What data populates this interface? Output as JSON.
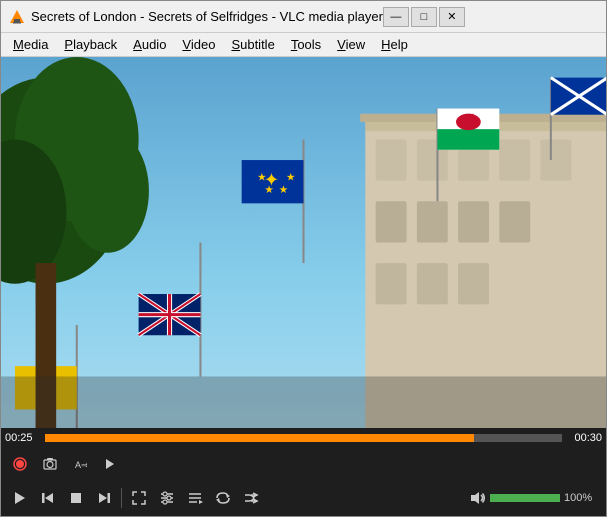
{
  "window": {
    "title": "Secrets of London - Secrets of Selfridges - VLC media player",
    "icon": "▶"
  },
  "titlebar": {
    "minimize": "—",
    "maximize": "□",
    "close": "✕"
  },
  "menu": {
    "items": [
      {
        "id": "media",
        "label": "Media",
        "underline": "M"
      },
      {
        "id": "playback",
        "label": "Playback",
        "underline": "P"
      },
      {
        "id": "audio",
        "label": "Audio",
        "underline": "A"
      },
      {
        "id": "video",
        "label": "Video",
        "underline": "V"
      },
      {
        "id": "subtitle",
        "label": "Subtitle",
        "underline": "S"
      },
      {
        "id": "tools",
        "label": "Tools",
        "underline": "T"
      },
      {
        "id": "view",
        "label": "View",
        "underline": "V"
      },
      {
        "id": "help",
        "label": "Help",
        "underline": "H"
      }
    ]
  },
  "player": {
    "time_current": "00:25",
    "time_total": "00:30",
    "progress_percent": 83,
    "volume_percent": 100,
    "volume_label": "100%"
  },
  "controls_row1": {
    "record_title": "Record",
    "snapshot_title": "Take snapshot",
    "loop_title": "Loop",
    "play_title": "Play"
  },
  "controls_row2": {
    "play_title": "Play",
    "prev_title": "Previous",
    "stop_title": "Stop",
    "next_title": "Next",
    "fullscreen_title": "Toggle fullscreen",
    "extended_title": "Show extended settings",
    "playlist_title": "Show playlist",
    "loop_title": "Toggle loop",
    "random_title": "Toggle random"
  },
  "colors": {
    "accent_orange": "#ff8800",
    "volume_green": "#4CAF50",
    "record_red": "#ff4444",
    "bg_dark": "#1e1e1e",
    "progress_bg": "#555"
  }
}
